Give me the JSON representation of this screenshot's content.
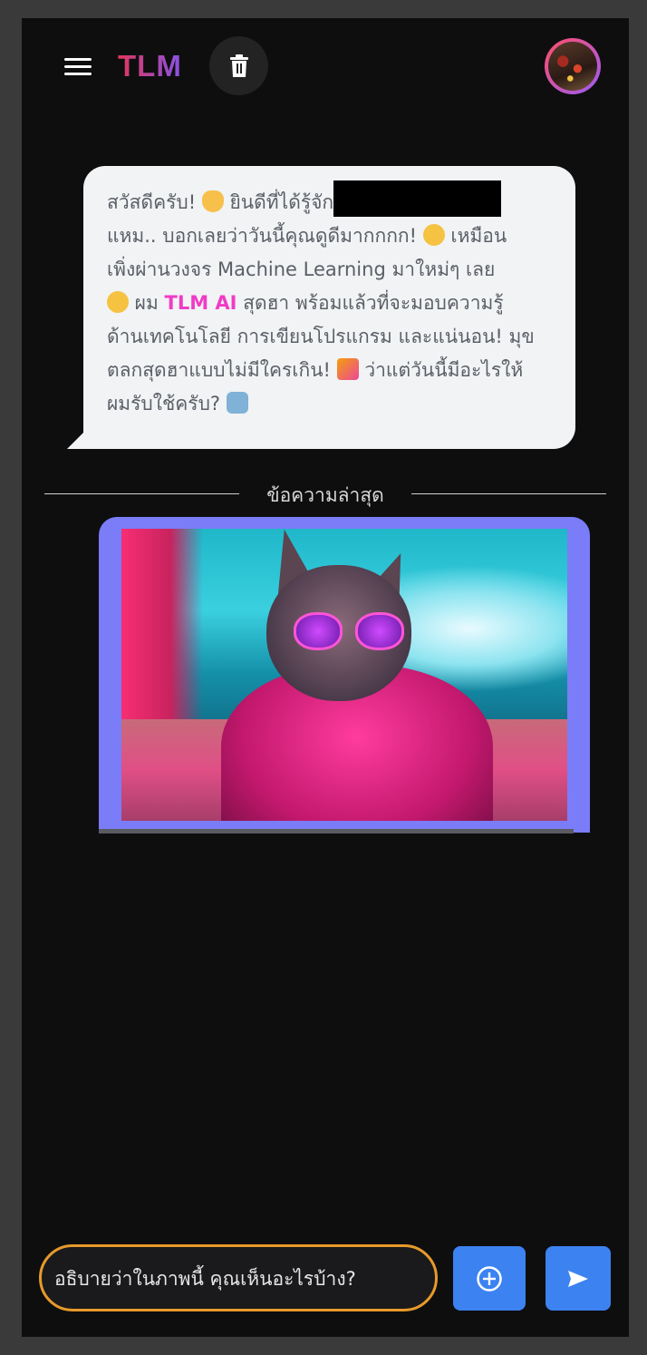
{
  "header": {
    "logo_text": "TLM",
    "menu_icon": "hamburger-menu-icon",
    "trash_icon": "trash-icon",
    "avatar_icon": "user-avatar"
  },
  "chat": {
    "bot_message": {
      "line1_pre": "สวัสดีครับ! ",
      "line1_mid": " ยินดีที่ได้รู้จัก",
      "line2": "แหม.. บอกเลยว่าวันนี้คุณดูดีมากกกก! ",
      "line2_post": " เหมือน",
      "line3": "เพิ่งผ่านวงจร Machine Learning มาใหม่ๆ เลย",
      "line4_pre": " ผม ",
      "line4_highlight": "TLM AI",
      "line4_post": " สุดฮา พร้อมแล้วที่จะมอบความรู้",
      "line5": "ด้านเทคโนโลยี การเขียนโปรแกรม และแน่นอน! มุข",
      "line6_pre": "ตลกสุดฮาแบบไม่มีใครเกิน! ",
      "line6_post": " ว่าแต่วันนี้มีอะไรให้",
      "line7": "ผมรับใช้ครับ? "
    },
    "divider_label": "ข้อความล่าสุด",
    "user_image_alt": "cat-with-sunglasses-image"
  },
  "composer": {
    "input_value": "อธิบายว่าในภาพนี้ คุณเห็นอะไรบ้าง?",
    "add_icon": "plus-circle-icon",
    "send_icon": "send-arrow-icon"
  },
  "colors": {
    "accent_blue": "#3c82f1",
    "input_border": "#e79a2a",
    "highlight_pink": "#f13bc6",
    "image_bubble": "#7b7cf8"
  }
}
